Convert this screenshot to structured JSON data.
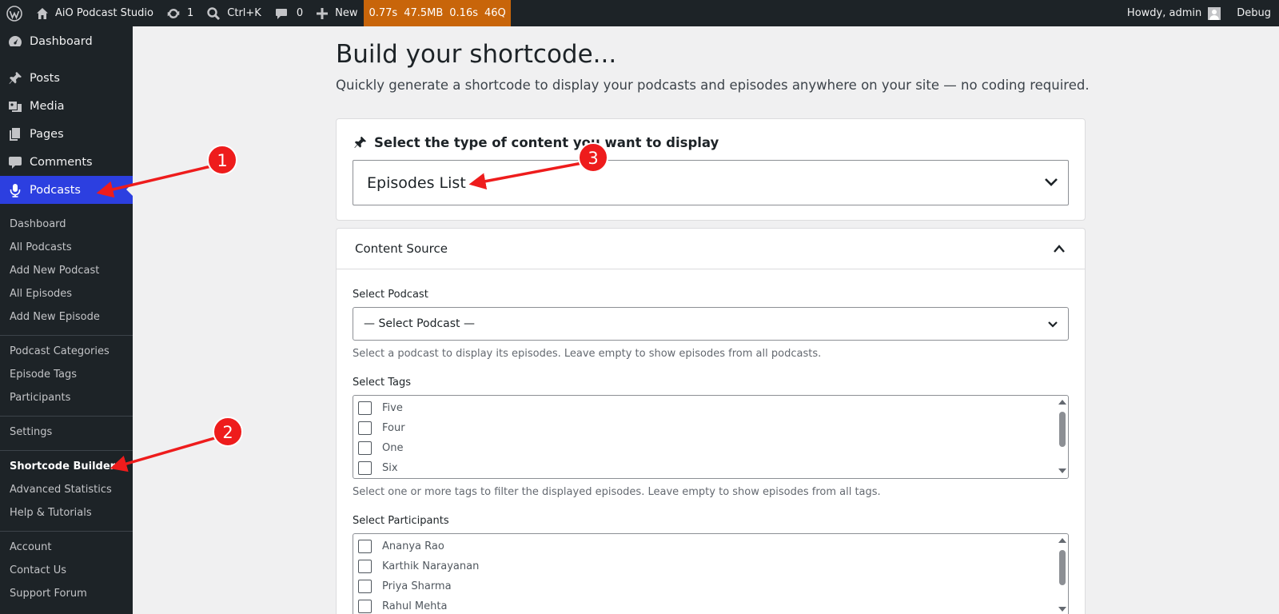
{
  "adminbar": {
    "site_name": "AiO Podcast Studio",
    "updates_count": "1",
    "search_shortcut": "Ctrl+K",
    "comments_count": "0",
    "new_label": "New",
    "qm": {
      "time": "0.77s",
      "memory": "47.5MB",
      "db_time": "0.16s",
      "queries": "46Q"
    },
    "howdy": "Howdy, admin",
    "debug": "Debug"
  },
  "sidebar": {
    "top_items": [
      "Dashboard",
      "Posts",
      "Media",
      "Pages",
      "Comments",
      "Podcasts"
    ],
    "sub_group1": [
      "Dashboard",
      "All Podcasts",
      "Add New Podcast",
      "All Episodes",
      "Add New Episode"
    ],
    "sub_group2": [
      "Podcast Categories",
      "Episode Tags",
      "Participants"
    ],
    "sub_group3": [
      "Settings"
    ],
    "sub_group4": [
      "Shortcode Builder",
      "Advanced Statistics",
      "Help & Tutorials"
    ],
    "sub_group5": [
      "Account",
      "Contact Us",
      "Support Forum"
    ]
  },
  "page": {
    "title": "Build your shortcode...",
    "subtitle": "Quickly generate a shortcode to display your podcasts and episodes anywhere on your site — no coding required."
  },
  "content_type": {
    "heading": "Select the type of content you want to display",
    "selected": "Episodes List"
  },
  "content_source": {
    "title": "Content Source",
    "podcast_label": "Select Podcast",
    "podcast_selected": "— Select Podcast —",
    "podcast_help": "Select a podcast to display its episodes. Leave empty to show episodes from all podcasts.",
    "tags_label": "Select Tags",
    "tags": [
      "Five",
      "Four",
      "One",
      "Six"
    ],
    "tags_help": "Select one or more tags to filter the displayed episodes. Leave empty to show episodes from all tags.",
    "participants_label": "Select Participants",
    "participants": [
      "Ananya Rao",
      "Karthik Narayanan",
      "Priya Sharma",
      "Rahul Mehta"
    ]
  },
  "annotations": [
    "1",
    "2",
    "3"
  ],
  "colors": {
    "accent": "#2c3fe0",
    "admin_bg": "#1d2327",
    "query_monitor": "#c8650a",
    "annotation_red": "#ee1c1c"
  }
}
